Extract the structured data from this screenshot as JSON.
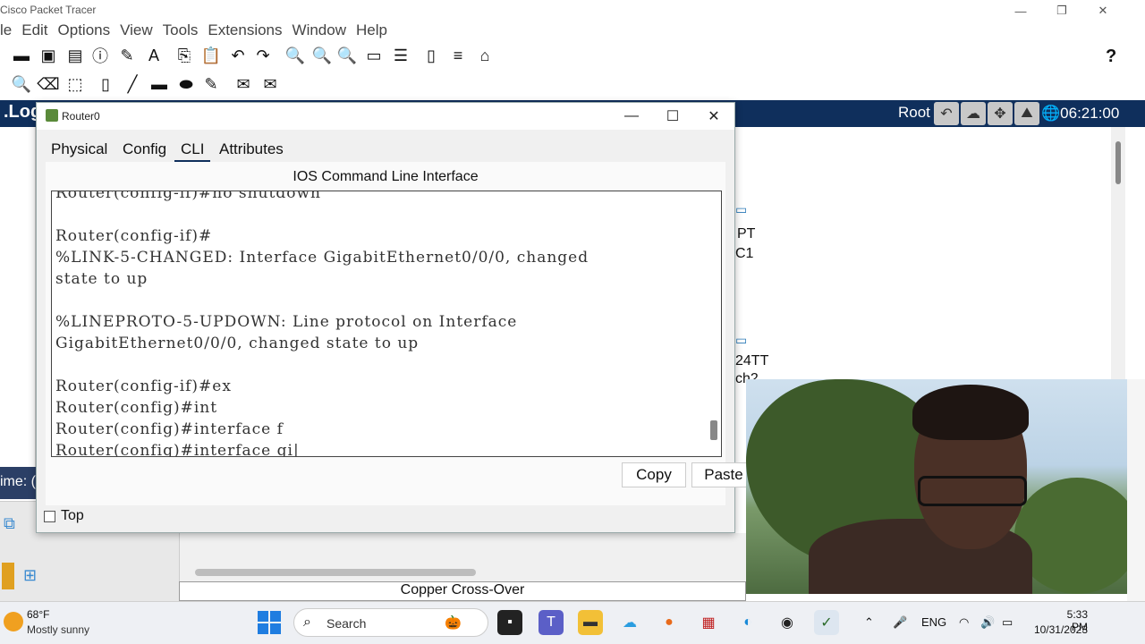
{
  "app": {
    "title": "Cisco Packet Tracer"
  },
  "menu": [
    "le",
    "Edit",
    "Options",
    "View",
    "Tools",
    "Extensions",
    "Window",
    "Help"
  ],
  "logical_tab": ".Log",
  "root_label": "Root",
  "clock": "06:21:00",
  "workspace_labels": [
    "PT",
    "C1",
    "24TT",
    "ch2"
  ],
  "time_label": "ime: (",
  "router_window": {
    "title": "Router0",
    "tabs": [
      "Physical",
      "Config",
      "CLI",
      "Attributes"
    ],
    "active_tab": "CLI",
    "cli_heading": "IOS Command Line Interface",
    "cli_lines": [
      "Router(config-if)#no shutdown",
      "",
      "Router(config-if)#",
      "%LINK-5-CHANGED: Interface GigabitEthernet0/0/0, changed",
      "state to up",
      "",
      "%LINEPROTO-5-UPDOWN: Line protocol on Interface",
      "GigabitEthernet0/0/0, changed state to up",
      "",
      "Router(config-if)#ex",
      "Router(config)#int",
      "Router(config)#interface f",
      "Router(config)#interface gi"
    ],
    "copy_label": "Copy",
    "paste_label": "Paste",
    "top_label": "Top"
  },
  "connection_label": "Copper Cross-Over",
  "taskbar": {
    "temperature": "68°F",
    "weather": "Mostly sunny",
    "search_placeholder": "Search",
    "language": "ENG",
    "time": "5:33 PM",
    "date": "10/31/2023"
  }
}
